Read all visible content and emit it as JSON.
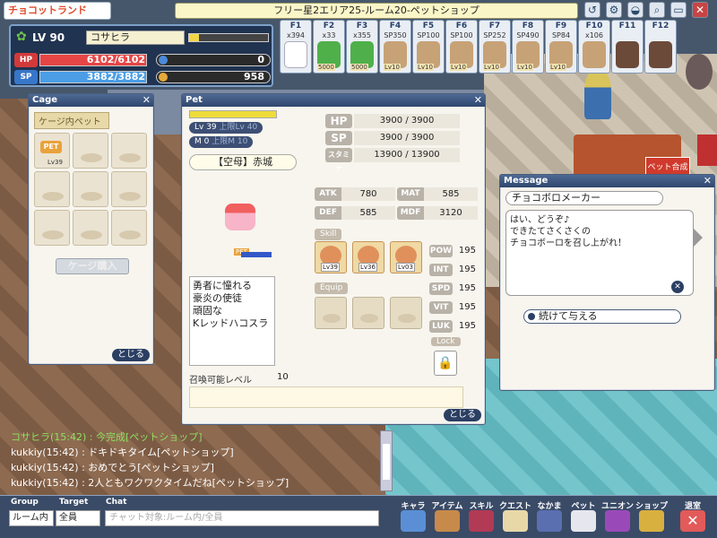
{
  "app": {
    "logo": "チョコットランド",
    "location": "フリー星2エリア25-ルーム20-ペットショップ"
  },
  "top_icons": [
    {
      "icon": "chat-icon",
      "label": "↺"
    },
    {
      "icon": "tool-icon",
      "label": "⚙"
    },
    {
      "icon": "pet-icon",
      "label": "◒"
    },
    {
      "icon": "magnify-icon",
      "label": "⌕"
    },
    {
      "icon": "window-icon",
      "label": "▭"
    },
    {
      "icon": "close-icon",
      "label": "✕"
    }
  ],
  "status": {
    "level": "LV 90",
    "name": "コサヒラ",
    "exp_ratio": 0.12,
    "hp_label": "HP",
    "hp": "6102/6102",
    "hp_ratio": 1.0,
    "sp_label": "SP",
    "sp": "3882/3882",
    "sp_ratio": 1.0,
    "right_val_1": "0",
    "right_val_2": "958"
  },
  "hotkeys": [
    {
      "key": "F1",
      "count": "x394",
      "icon": "feather-icon"
    },
    {
      "key": "F2",
      "count": "x33",
      "icon": "potion-icon",
      "badge": "5000"
    },
    {
      "key": "F3",
      "count": "x355",
      "icon": "potion-icon",
      "badge": "5000"
    },
    {
      "key": "F4",
      "count": "SP350",
      "icon": "skill-icon",
      "badge": "Lv10"
    },
    {
      "key": "F5",
      "count": "SP100",
      "icon": "skill-icon",
      "badge": "Lv10"
    },
    {
      "key": "F6",
      "count": "SP100",
      "icon": "skill-icon",
      "badge": "Lv10"
    },
    {
      "key": "F7",
      "count": "SP252",
      "icon": "skill-icon",
      "badge": "Lv10"
    },
    {
      "key": "F8",
      "count": "SP490",
      "icon": "skill-icon",
      "badge": "Lv10"
    },
    {
      "key": "F9",
      "count": "SP84",
      "icon": "skill-icon",
      "badge": "Lv10"
    },
    {
      "key": "F10",
      "count": "x106",
      "icon": "egg-icon"
    },
    {
      "key": "F11",
      "count": "",
      "icon": "pet-summon-icon"
    },
    {
      "key": "F12",
      "count": "",
      "icon": "pet-summon-icon"
    }
  ],
  "cage": {
    "title": "Cage",
    "subtitle": "ケージ内ペット",
    "pet_tag": "PET",
    "pet_level": "Lv39",
    "buy_button": "ケージ購入",
    "close": "とじる"
  },
  "pet": {
    "title": "Pet",
    "lv": "Lv 39",
    "lv_cap": "上限Lv 40",
    "m": "M 0",
    "m_cap": "上限M 10",
    "name": "【空母】赤城",
    "desc": [
      "勇者に憧れる",
      "豪炎の使徒",
      "頑固な",
      "Kレッドハコスラ"
    ],
    "mini_tag": "PET",
    "summon_label": "召喚可能レベル",
    "summon_value": "10",
    "big_stats": [
      {
        "label": "HP",
        "value": "3900 / 3900"
      },
      {
        "label": "SP",
        "value": "3900 / 3900"
      },
      {
        "label": "スタミナ",
        "value": "13900 / 13900"
      }
    ],
    "atk_label": "ATK",
    "atk": "780",
    "mat_label": "MAT",
    "mat": "585",
    "def_label": "DEF",
    "def": "585",
    "mdf_label": "MDF",
    "mdf": "3120",
    "skill_label": "Skill",
    "skills": [
      {
        "icon": "skill-face-icon",
        "level": "Lv39"
      },
      {
        "icon": "hp-skill-icon",
        "level": "Lv36"
      },
      {
        "icon": "hp-skill-icon",
        "level": "Lv03"
      }
    ],
    "equip_label": "Equip",
    "pow_label": "POW",
    "pow": "195",
    "int_label": "INT",
    "int": "195",
    "spd_label": "SPD",
    "spd": "195",
    "vit_label": "VIT",
    "vit": "195",
    "luk_label": "LUK",
    "luk": "195",
    "lock_label": "Lock",
    "close": "とじる"
  },
  "message": {
    "title": "Message",
    "speaker": "チョコボロメーカー",
    "body": "はい、どうぞ♪\nできたてさくさくの\nチョコボーロを召し上がれ！",
    "option": "続けて与える"
  },
  "chat": {
    "lines": [
      "コサヒラ(15:42) : 今完成[ペットショップ]",
      "kukkiy(15:42) : ドキドキタイム[ペットショップ]",
      "kukkiy(15:42) : おめでとう[ペットショップ]",
      "kukkiy(15:42) : 2人ともワクワクタイムだね[ペットショップ]"
    ],
    "group_label": "Group",
    "group_value": "ルーム内",
    "target_label": "Target",
    "target_value": "全員",
    "chat_label": "Chat",
    "input_placeholder": "チャット対象:ルーム内/全員"
  },
  "menu": [
    {
      "label": "キャラ",
      "icon": "character-icon"
    },
    {
      "label": "アイテム",
      "icon": "bag-icon"
    },
    {
      "label": "スキル",
      "icon": "book-icon"
    },
    {
      "label": "クエスト",
      "icon": "scroll-icon"
    },
    {
      "label": "なかま",
      "icon": "friends-icon"
    },
    {
      "label": "ペット",
      "icon": "pet-menu-icon"
    },
    {
      "label": "ユニオン",
      "icon": "union-icon"
    },
    {
      "label": "ショップ",
      "icon": "shop-icon"
    },
    {
      "label": "退室",
      "icon": "exit-icon"
    }
  ]
}
